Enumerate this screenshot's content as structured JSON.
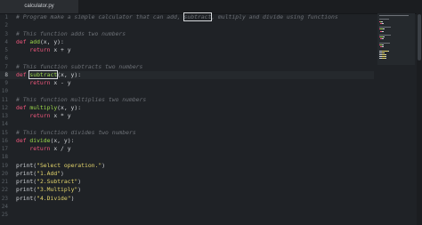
{
  "tab": {
    "filename": "calculator.py",
    "close_glyph": "×"
  },
  "editor": {
    "active_line": "8",
    "lines": [
      {
        "num": "1",
        "parts": [
          {
            "t": "# Program make a simple calculator that can add, ",
            "c": "cm"
          },
          {
            "t": "subtract",
            "c": "cm hl"
          },
          {
            "t": ", multiply and divide using functions",
            "c": "cm"
          }
        ]
      },
      {
        "num": "2",
        "parts": []
      },
      {
        "num": "3",
        "parts": [
          {
            "t": "# This function adds two numbers",
            "c": "cm"
          }
        ]
      },
      {
        "num": "4",
        "parts": [
          {
            "t": "def ",
            "c": "kw"
          },
          {
            "t": "add",
            "c": "fn"
          },
          {
            "t": "(x, y):",
            "c": "id"
          }
        ]
      },
      {
        "num": "5",
        "parts": [
          {
            "t": "    return ",
            "c": "kw"
          },
          {
            "t": "x + y",
            "c": "id"
          }
        ]
      },
      {
        "num": "6",
        "parts": []
      },
      {
        "num": "7",
        "parts": [
          {
            "t": "# This function subtracts two numbers",
            "c": "cm"
          }
        ]
      },
      {
        "num": "8",
        "parts": [
          {
            "t": "def ",
            "c": "kw"
          },
          {
            "t": "subtract",
            "c": "fn hl"
          },
          {
            "t": "(x, y):",
            "c": "id"
          }
        ]
      },
      {
        "num": "9",
        "parts": [
          {
            "t": "    return ",
            "c": "kw"
          },
          {
            "t": "x - y",
            "c": "id"
          }
        ]
      },
      {
        "num": "10",
        "parts": []
      },
      {
        "num": "11",
        "parts": [
          {
            "t": "# This function multiplies two numbers",
            "c": "cm"
          }
        ]
      },
      {
        "num": "12",
        "parts": [
          {
            "t": "def ",
            "c": "kw"
          },
          {
            "t": "multiply",
            "c": "fn"
          },
          {
            "t": "(x, y):",
            "c": "id"
          }
        ]
      },
      {
        "num": "13",
        "parts": [
          {
            "t": "    return ",
            "c": "kw"
          },
          {
            "t": "x * y",
            "c": "id"
          }
        ]
      },
      {
        "num": "14",
        "parts": []
      },
      {
        "num": "15",
        "parts": [
          {
            "t": "# This function divides two numbers",
            "c": "cm"
          }
        ]
      },
      {
        "num": "16",
        "parts": [
          {
            "t": "def ",
            "c": "kw"
          },
          {
            "t": "divide",
            "c": "fn"
          },
          {
            "t": "(x, y):",
            "c": "id"
          }
        ]
      },
      {
        "num": "17",
        "parts": [
          {
            "t": "    return ",
            "c": "kw"
          },
          {
            "t": "x / y",
            "c": "id"
          }
        ]
      },
      {
        "num": "18",
        "parts": []
      },
      {
        "num": "19",
        "parts": [
          {
            "t": "print",
            "c": "id"
          },
          {
            "t": "(",
            "c": "id"
          },
          {
            "t": "\"Select operation.\"",
            "c": "st"
          },
          {
            "t": ")",
            "c": "id"
          }
        ]
      },
      {
        "num": "20",
        "parts": [
          {
            "t": "print",
            "c": "id"
          },
          {
            "t": "(",
            "c": "id"
          },
          {
            "t": "\"1.Add\"",
            "c": "st"
          },
          {
            "t": ")",
            "c": "id"
          }
        ]
      },
      {
        "num": "21",
        "parts": [
          {
            "t": "print",
            "c": "id"
          },
          {
            "t": "(",
            "c": "id"
          },
          {
            "t": "\"2.Subtract\"",
            "c": "st"
          },
          {
            "t": ")",
            "c": "id"
          }
        ]
      },
      {
        "num": "22",
        "parts": [
          {
            "t": "print",
            "c": "id"
          },
          {
            "t": "(",
            "c": "id"
          },
          {
            "t": "\"3.Multiply\"",
            "c": "st"
          },
          {
            "t": ")",
            "c": "id"
          }
        ]
      },
      {
        "num": "23",
        "parts": [
          {
            "t": "print",
            "c": "id"
          },
          {
            "t": "(",
            "c": "id"
          },
          {
            "t": "\"4.Divide\"",
            "c": "st"
          },
          {
            "t": ")",
            "c": "id"
          }
        ]
      },
      {
        "num": "24",
        "parts": []
      },
      {
        "num": "25",
        "parts": []
      }
    ]
  },
  "colors": {
    "background": "#1f2226",
    "comment": "#6d7177",
    "keyword": "#f0577c",
    "function": "#9cd84a",
    "string": "#e3d46b",
    "text": "#cfd2d6"
  }
}
